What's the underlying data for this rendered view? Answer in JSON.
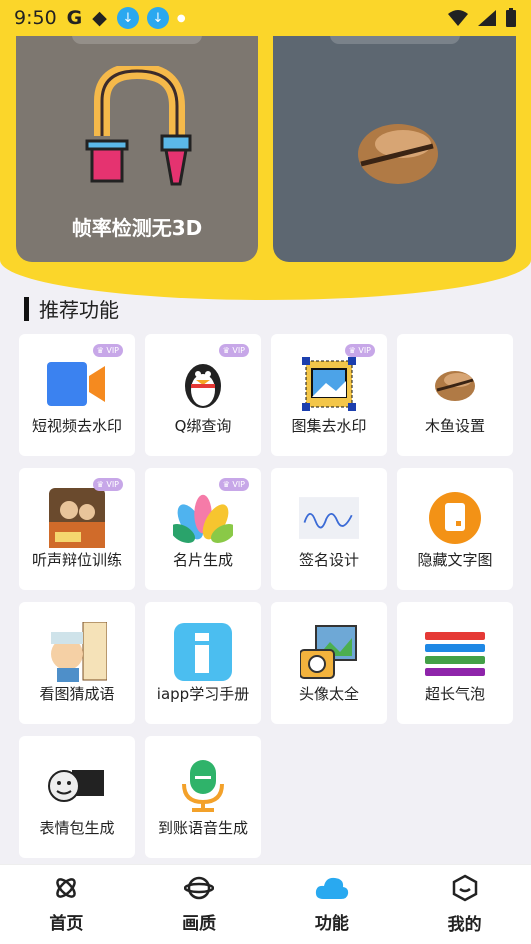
{
  "status": {
    "time": "9:50",
    "g": "G"
  },
  "cards": [
    {
      "caption": "帧率检测无3D"
    },
    {
      "caption": ""
    }
  ],
  "section": {
    "title": "推荐功能"
  },
  "vip_text": "VIP",
  "features": [
    {
      "label": "短视频去水印",
      "icon": "video-camera-icon",
      "vip": true
    },
    {
      "label": "Q绑查询",
      "icon": "penguin-icon",
      "vip": true
    },
    {
      "label": "图集去水印",
      "icon": "image-frame-icon",
      "vip": true
    },
    {
      "label": "木鱼设置",
      "icon": "wooden-fish-icon",
      "vip": false
    },
    {
      "label": "听声辩位训练",
      "icon": "game-poster-icon",
      "vip": true
    },
    {
      "label": "名片生成",
      "icon": "petals-icon",
      "vip": true
    },
    {
      "label": "签名设计",
      "icon": "signature-icon",
      "vip": false
    },
    {
      "label": "隐藏文字图",
      "icon": "hidden-text-icon",
      "vip": false
    },
    {
      "label": "看图猜成语",
      "icon": "idiom-icon",
      "vip": false
    },
    {
      "label": "iapp学习手册",
      "icon": "info-book-icon",
      "vip": false
    },
    {
      "label": "头像太全",
      "icon": "avatar-camera-icon",
      "vip": false
    },
    {
      "label": "超长气泡",
      "icon": "bubble-list-icon",
      "vip": false
    },
    {
      "label": "表情包生成",
      "icon": "meme-icon",
      "vip": false
    },
    {
      "label": "到账语音生成",
      "icon": "microphone-icon",
      "vip": false
    }
  ],
  "nav": [
    {
      "label": "首页",
      "icon": "atom-icon"
    },
    {
      "label": "画质",
      "icon": "planet-icon"
    },
    {
      "label": "功能",
      "icon": "cloud-icon"
    },
    {
      "label": "我的",
      "icon": "cube-icon"
    }
  ],
  "colors": {
    "accent": "#fbd62a",
    "background": "#f1f0f5"
  }
}
